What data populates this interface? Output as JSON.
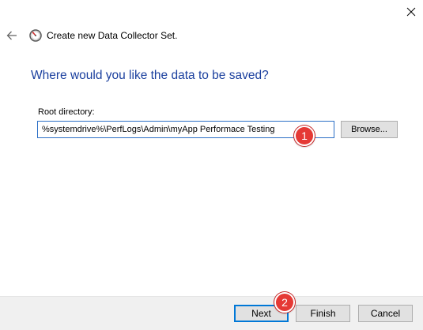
{
  "window": {
    "title": "Create new Data Collector Set."
  },
  "icons": {
    "close": "close-icon",
    "back": "back-arrow-icon",
    "app": "performance-monitor-icon"
  },
  "page": {
    "heading": "Where would you like the data to be saved?",
    "root_directory_label": "Root directory:",
    "root_directory_value": "%systemdrive%\\PerfLogs\\Admin\\myApp Performace Testing",
    "browse_label": "Browse..."
  },
  "footer": {
    "next_label": "Next",
    "finish_label": "Finish",
    "cancel_label": "Cancel"
  },
  "annotations": {
    "step1": "1",
    "step2": "2"
  },
  "colors": {
    "heading": "#1a3f9e",
    "input_border_focus": "#2b6fc6",
    "default_button_border": "#0078d7",
    "badge": "#e53935"
  }
}
